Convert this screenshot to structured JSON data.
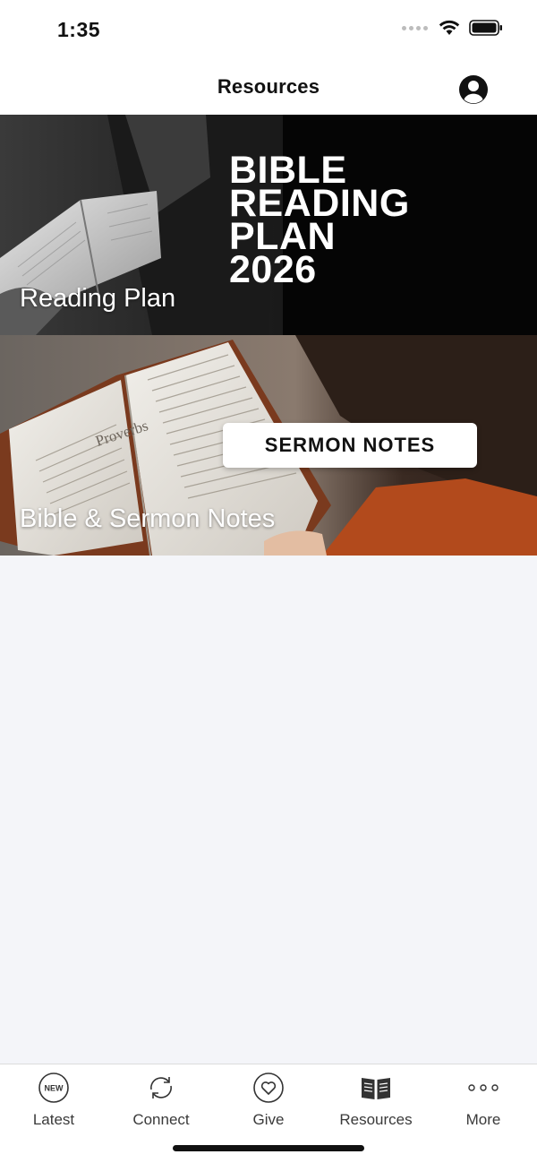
{
  "status_bar": {
    "time": "1:35"
  },
  "header": {
    "title": "Resources"
  },
  "cards": [
    {
      "label": "Reading Plan",
      "image_text": [
        "BIBLE",
        "READING",
        "PLAN",
        "2026"
      ]
    },
    {
      "label": "Bible & Sermon Notes",
      "image_text": "SERMON NOTES",
      "book_page_text": "Proverbs"
    }
  ],
  "tab_bar": {
    "items": [
      {
        "label": "Latest",
        "icon": "new-badge-icon",
        "icon_text": "NEW"
      },
      {
        "label": "Connect",
        "icon": "connect-arrows-icon"
      },
      {
        "label": "Give",
        "icon": "heart-circle-icon"
      },
      {
        "label": "Resources",
        "icon": "book-icon"
      },
      {
        "label": "More",
        "icon": "more-dots-icon"
      }
    ]
  },
  "colors": {
    "background": "#f4f5f9",
    "bar_background": "#ffffff",
    "text": "#111111"
  }
}
